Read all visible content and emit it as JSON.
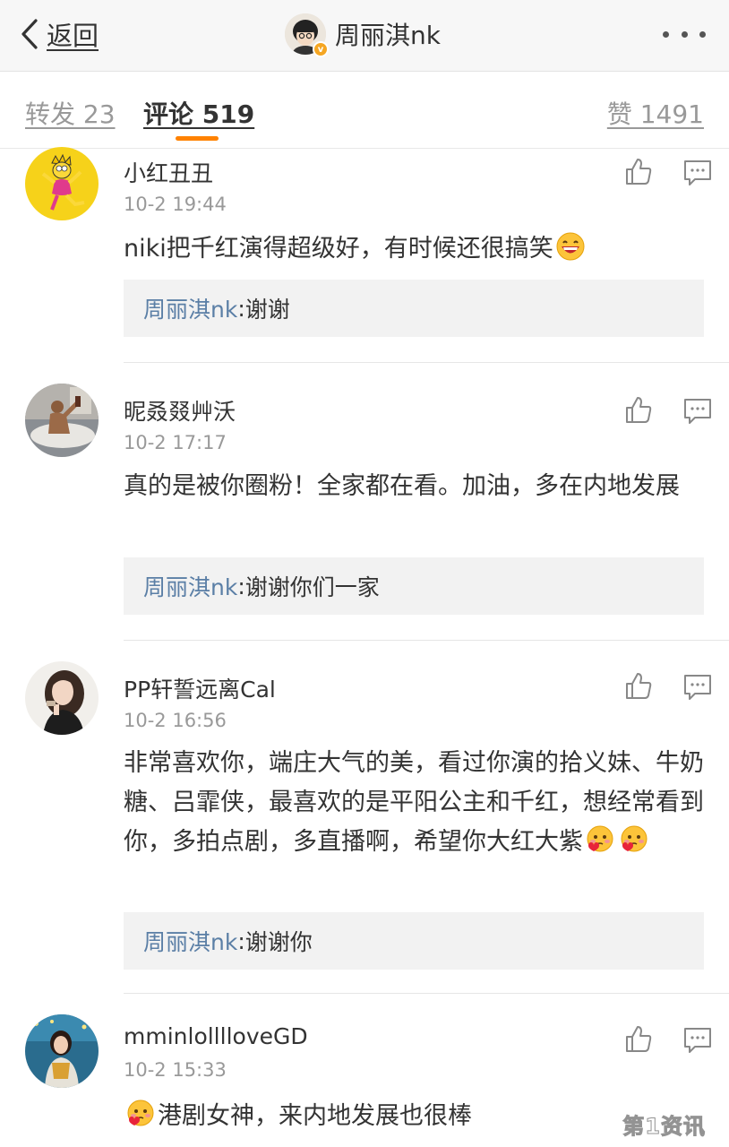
{
  "nav": {
    "back_label": "返回",
    "title": "周丽淇nk",
    "verified_badge": "v",
    "colors": {
      "accent": "#ff8200",
      "link": "#5b7fa6",
      "badge": "#f5a623"
    }
  },
  "tabs": {
    "repost_label": "转发 23",
    "comments_label": "评论 519",
    "likes_label": "赞 1491",
    "active": "comments"
  },
  "comments": [
    {
      "username": "小红丑丑",
      "time": "10-2 19:44",
      "text": "niki把千红演得超级好，有时候还很搞笑",
      "emojis": [
        "laughing-emoji"
      ],
      "reply": {
        "name": "周丽淇nk",
        "sep": ": ",
        "text": "谢谢"
      }
    },
    {
      "username": "昵叒叕艸沃",
      "time": "10-2 17:17",
      "text": "真的是被你圈粉！全家都在看。加油，多在内地发展",
      "reply": {
        "name": "周丽淇nk",
        "sep": ": ",
        "text": "谢谢你们一家"
      }
    },
    {
      "username": "PP轩誓远离Cal",
      "time": "10-2 16:56",
      "text": "非常喜欢你，端庄大气的美，看过你演的拾义妹、牛奶糖、吕霏侠，最喜欢的是平阳公主和千红，想经常看到你，多拍点剧，多直播啊，希望你大红大紫",
      "emojis": [
        "heart-blush-emoji",
        "heart-blush-emoji"
      ],
      "reply": {
        "name": "周丽淇nk",
        "sep": ": ",
        "text": "谢谢你"
      }
    },
    {
      "username": "mminlolllloveGD",
      "time": "10-2 15:33",
      "text": "港剧女神，来内地发展也很棒",
      "emojis": [
        "heart-blush-emoji"
      ]
    }
  ],
  "icons": [
    "back-chevron-icon",
    "more-icon",
    "like-icon",
    "reply-icon"
  ],
  "watermark": "第1资讯"
}
